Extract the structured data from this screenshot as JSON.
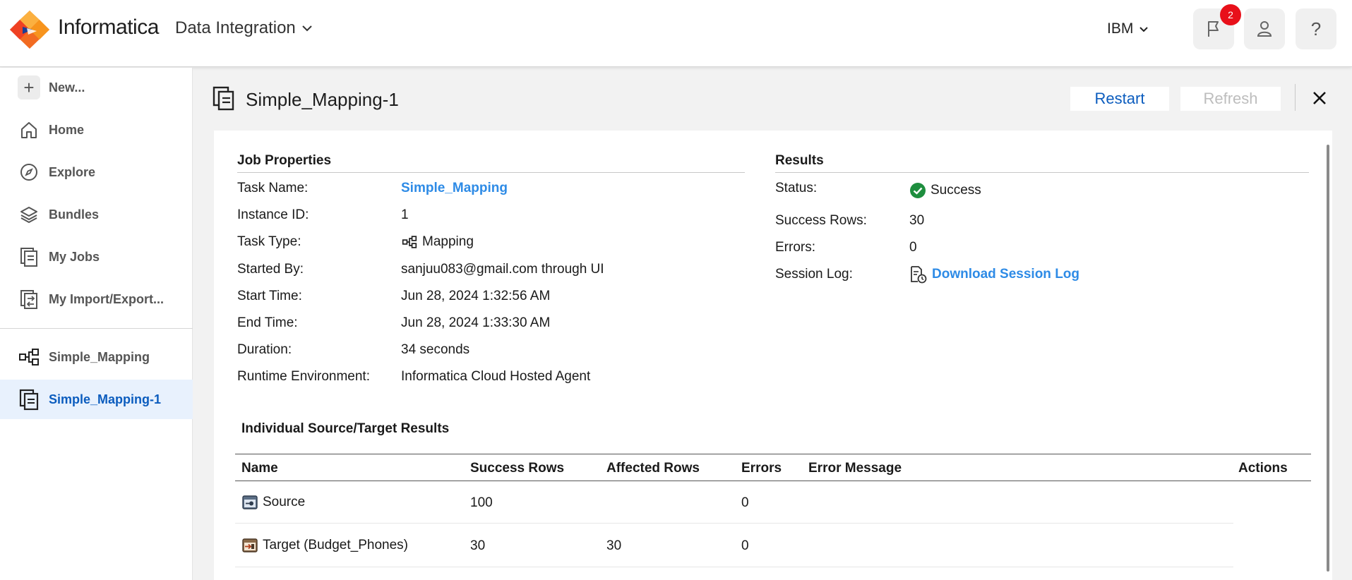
{
  "header": {
    "brand": "Informatica",
    "product": "Data Integration",
    "org": "IBM",
    "notifications_count": "2",
    "help_label": "?"
  },
  "sidebar": {
    "items": [
      {
        "label": "New...",
        "icon": "plus-icon"
      },
      {
        "label": "Home",
        "icon": "home-icon"
      },
      {
        "label": "Explore",
        "icon": "compass-icon"
      },
      {
        "label": "Bundles",
        "icon": "layers-icon"
      },
      {
        "label": "My Jobs",
        "icon": "jobs-icon"
      },
      {
        "label": "My Import/Export...",
        "icon": "import-export-icon"
      }
    ],
    "open_tabs": [
      {
        "label": "Simple_Mapping",
        "icon": "mapping-icon"
      },
      {
        "label": "Simple_Mapping-1",
        "icon": "job-icon",
        "active": true
      }
    ]
  },
  "page": {
    "title": "Simple_Mapping-1",
    "restart_label": "Restart",
    "refresh_label": "Refresh"
  },
  "job_properties": {
    "heading": "Job Properties",
    "rows": [
      {
        "label": "Task Name:",
        "value": "Simple_Mapping"
      },
      {
        "label": "Instance ID:",
        "value": "1"
      },
      {
        "label": "Task Type:",
        "value": "Mapping"
      },
      {
        "label": "Started By:",
        "value": "sanjuu083@gmail.com through UI"
      },
      {
        "label": "Start Time:",
        "value": "Jun 28, 2024 1:32:56 AM"
      },
      {
        "label": "End Time:",
        "value": "Jun 28, 2024 1:33:30 AM"
      },
      {
        "label": "Duration:",
        "value": "34 seconds"
      },
      {
        "label": "Runtime Environment:",
        "value": "Informatica Cloud Hosted Agent"
      }
    ]
  },
  "results": {
    "heading": "Results",
    "rows": [
      {
        "label": "Status:",
        "value": "Success"
      },
      {
        "label": "Success Rows:",
        "value": "30"
      },
      {
        "label": "Errors:",
        "value": "0"
      },
      {
        "label": "Session Log:",
        "value": "Download Session Log"
      }
    ],
    "success_color": "#1e8e3e"
  },
  "source_target": {
    "heading": "Individual Source/Target Results",
    "columns": [
      "Name",
      "Success Rows",
      "Affected Rows",
      "Errors",
      "Error Message",
      "Actions"
    ],
    "rows": [
      {
        "name": "Source",
        "success_rows": "100",
        "affected_rows": "",
        "errors": "0",
        "error_message": "",
        "icon": "source-icon"
      },
      {
        "name": "Target (Budget_Phones)",
        "success_rows": "30",
        "affected_rows": "30",
        "errors": "0",
        "error_message": "",
        "icon": "target-icon"
      }
    ]
  },
  "colors": {
    "accent": "#0b5cbe",
    "link": "#2e8be6",
    "badge": "#e8101a"
  }
}
